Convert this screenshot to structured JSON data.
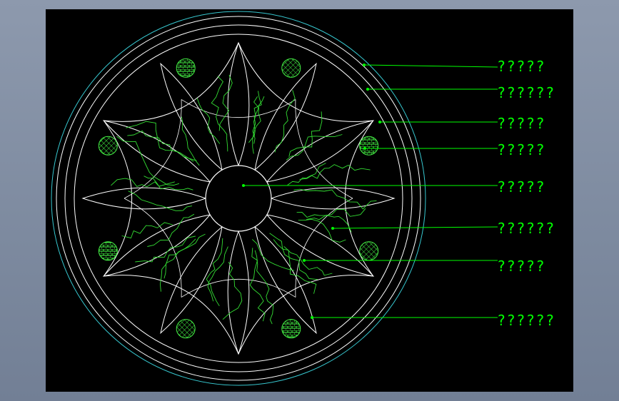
{
  "colors": {
    "background_outer": "#7e8ba0",
    "canvas": "#000000",
    "outline": "#ffffff",
    "outer_ring": "#37c8d0",
    "leader": "#00ff00",
    "label": "#00ff00",
    "crack": "#33dd33",
    "hatch": "#44ee44"
  },
  "labels": [
    {
      "text": "?????"
    },
    {
      "text": "??????"
    },
    {
      "text": "?????"
    },
    {
      "text": "?????"
    },
    {
      "text": "?????"
    },
    {
      "text": "??????"
    },
    {
      "text": "?????"
    },
    {
      "text": "??????"
    }
  ]
}
